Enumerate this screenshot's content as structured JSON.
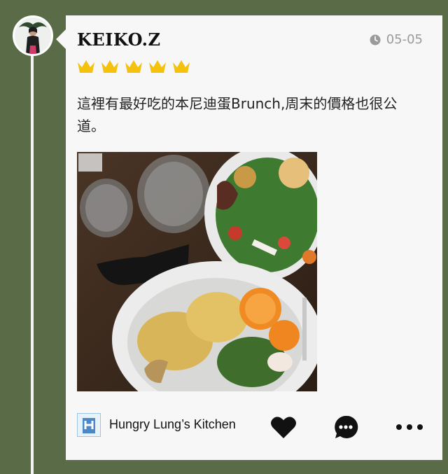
{
  "post": {
    "username": "KEIKO.Z",
    "date": "05-05",
    "rating": 5,
    "review_text": "這裡有最好吃的本尼迪蛋Brunch,周末的價格也很公道。",
    "venue_name": "Hungry Lung’s Kitchen"
  },
  "icons": {
    "clock": "clock-icon",
    "crown": "crown-icon",
    "venue": "building-icon",
    "like": "heart-icon",
    "comment": "comment-icon",
    "more": "more-icon"
  },
  "colors": {
    "background": "#5a6b47",
    "card": "#f7f7f7",
    "crown": "#f4c20d",
    "text": "#111111",
    "date": "#9a9a9a"
  }
}
